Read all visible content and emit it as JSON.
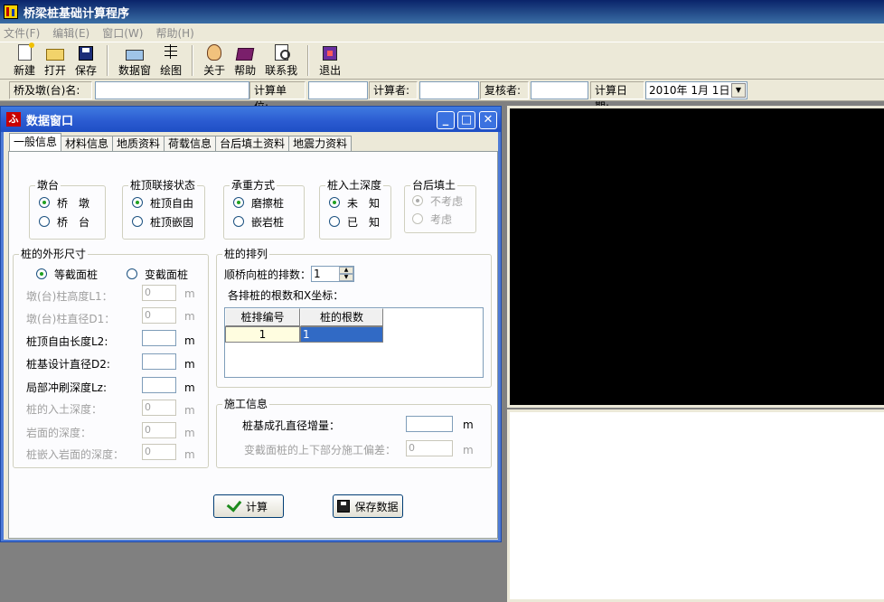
{
  "app": {
    "title": "桥梁桩基础计算程序"
  },
  "menu": [
    {
      "label": "文件(F)"
    },
    {
      "label": "编辑(E)"
    },
    {
      "label": "窗口(W)"
    },
    {
      "label": "帮助(H)"
    }
  ],
  "toolbar": [
    {
      "label": "新建",
      "icon": "new-icon"
    },
    {
      "label": "打开",
      "icon": "open-icon"
    },
    {
      "label": "保存",
      "icon": "save-icon"
    },
    {
      "label": "数据窗",
      "icon": "data-window-icon"
    },
    {
      "label": "绘图",
      "icon": "draw-icon"
    },
    {
      "label": "关于",
      "icon": "about-icon"
    },
    {
      "label": "帮助",
      "icon": "help-icon"
    },
    {
      "label": "联系我",
      "icon": "contact-icon"
    },
    {
      "label": "退出",
      "icon": "exit-icon"
    }
  ],
  "infobar": {
    "bridge_label": "桥及墩(台)名:",
    "bridge_value": "",
    "unit_label": "计算单位:",
    "unit_value": "",
    "calculator_label": "计算者:",
    "calculator_value": "",
    "reviewer_label": "复核者:",
    "reviewer_value": "",
    "date_label": "计算日期:",
    "date_value": "2010年 1月 1日"
  },
  "datawin": {
    "title": "数据窗口",
    "icon_glyph": "ふ",
    "tabs": [
      "一般信息",
      "材料信息",
      "地质资料",
      "荷载信息",
      "台后填土资料",
      "地震力资料"
    ],
    "active_tab": 0,
    "pier": {
      "title": "墩台",
      "opt1": "桥　墩",
      "opt2": "桥　台",
      "selected": 1
    },
    "pile_top": {
      "title": "桩顶联接状态",
      "opt1": "桩顶自由",
      "opt2": "桩顶嵌固",
      "selected": 1
    },
    "bearing": {
      "title": "承重方式",
      "opt1": "磨擦桩",
      "opt2": "嵌岩桩",
      "selected": 1
    },
    "depth": {
      "title": "桩入土深度",
      "opt1": "未　知",
      "opt2": "已　知",
      "selected": 1
    },
    "backfill": {
      "title": "台后填土",
      "opt1": "不考虑",
      "opt2": "考虑",
      "selected": 1
    },
    "shape": {
      "title": "桩的外形尺寸",
      "opt1": "等截面桩",
      "opt2": "变截面桩",
      "fields": [
        {
          "label": "墩(台)柱高度L1：",
          "value": "0",
          "unit": "m",
          "enabled": false
        },
        {
          "label": "墩(台)柱直径D1：",
          "value": "0",
          "unit": "m",
          "enabled": false
        },
        {
          "label": "桩顶自由长度L2:",
          "value": "",
          "unit": "m",
          "enabled": true
        },
        {
          "label": "桩基设计直径D2:",
          "value": "",
          "unit": "m",
          "enabled": true
        },
        {
          "label": "局部冲刷深度Lz:",
          "value": "",
          "unit": "m",
          "enabled": true
        },
        {
          "label": "桩的入土深度：",
          "value": "0",
          "unit": "m",
          "enabled": false
        },
        {
          "label": "岩面的深度：",
          "value": "0",
          "unit": "m",
          "enabled": false
        },
        {
          "label": "桩嵌入岩面的深度：",
          "value": "0",
          "unit": "m",
          "enabled": false
        }
      ]
    },
    "arrangement": {
      "title": "桩的排列",
      "rows_label": "顺桥向桩的排数：",
      "rows_value": "1",
      "grid_caption": "各排桩的根数和X坐标：",
      "col1": "桩排编号",
      "col2": "桩的根数",
      "row1_no": "1",
      "row1_count": "1"
    },
    "construction": {
      "title": "施工信息",
      "field1_label": "桩基成孔直径增量：",
      "field1_value": "",
      "field1_unit": "m",
      "field2_label": "变截面桩的上下部分施工偏差：",
      "field2_value": "0",
      "field2_unit": "m"
    },
    "calc_btn": "计算",
    "save_btn": "保存数据"
  },
  "colors": {
    "titlebar": "#0a246a",
    "dw_title": "#2a5ad0",
    "face": "#ece9d8",
    "grid_selected": "#316ac5"
  }
}
